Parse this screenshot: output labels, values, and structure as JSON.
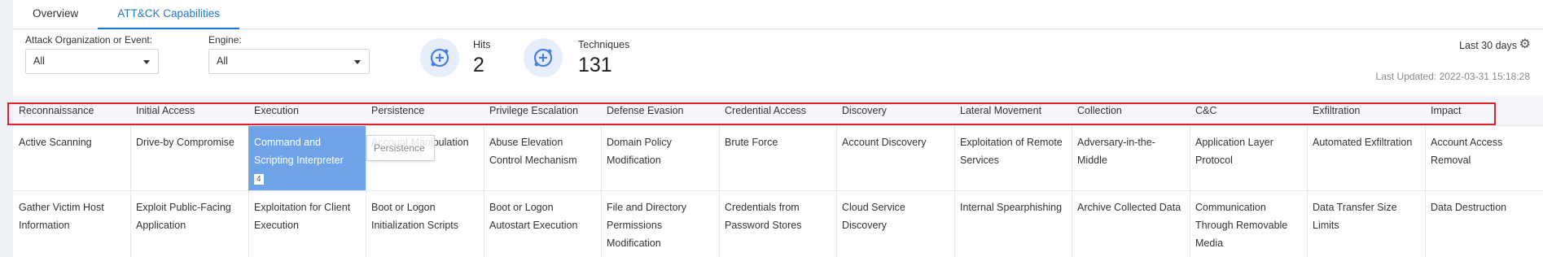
{
  "tabs": [
    "Overview",
    "ATT&CK Capabilities"
  ],
  "filters": {
    "org_label": "Attack Organization or Event:",
    "org_value": "All",
    "engine_label": "Engine:",
    "engine_value": "All"
  },
  "stats": {
    "hits_label": "Hits",
    "hits_value": "2",
    "techniques_label": "Techniques",
    "techniques_value": "131"
  },
  "time_range": "Last 30 days",
  "last_updated": "Last Updated: 2022-03-31 15:18:28",
  "tactics": [
    "Reconnaissance",
    "Initial Access",
    "Execution",
    "Persistence",
    "Privilege Escalation",
    "Defense Evasion",
    "Credential Access",
    "Discovery",
    "Lateral Movement",
    "Collection",
    "C&C",
    "Exfiltration",
    "Impact"
  ],
  "rows": [
    [
      "Active Scanning",
      "Drive-by Compromise",
      "Command and Scripting Interpreter",
      "Account Manipulation",
      "Abuse Elevation Control Mechanism",
      "Domain Policy Modification",
      "Brute Force",
      "Account Discovery",
      "Exploitation of Remote Services",
      "Adversary-in-the-Middle",
      "Application Layer Protocol",
      "Automated Exfiltration",
      "Account Access Removal"
    ],
    [
      "Gather Victim Host Information",
      "Exploit Public-Facing Application",
      "Exploitation for Client Execution",
      "Boot or Logon Initialization Scripts",
      "Boot or Logon Autostart Execution",
      "File and Directory Permissions Modification",
      "Credentials from Password Stores",
      "Cloud Service Discovery",
      "Internal Spearphishing",
      "Archive Collected Data",
      "Communication Through Removable Media",
      "Data Transfer Size Limits",
      "Data Destruction"
    ]
  ],
  "selected_hits": "4",
  "tooltip": "Persistence",
  "colors": {
    "accent": "#1f78d1",
    "selected_cell": "#6fa3e8",
    "highlight_box": "#e2222a"
  }
}
